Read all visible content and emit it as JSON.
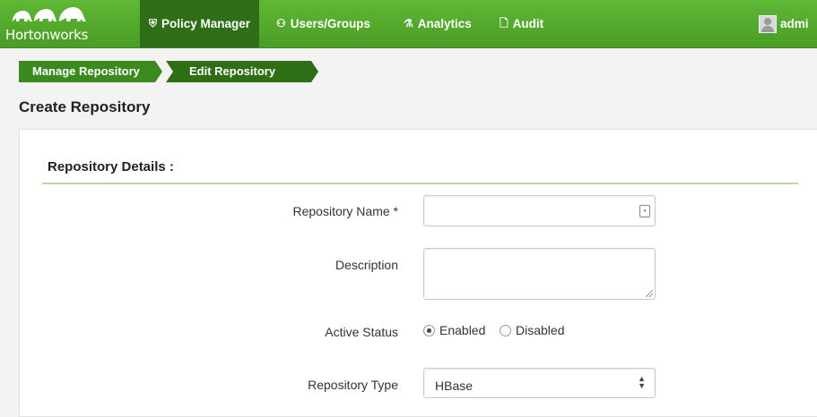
{
  "brand": {
    "name": "Hortonworks"
  },
  "nav": {
    "items": [
      {
        "label": "Policy Manager",
        "icon": "shield-icon",
        "active": true
      },
      {
        "label": "Users/Groups",
        "icon": "users-icon",
        "active": false
      },
      {
        "label": "Analytics",
        "icon": "flask-icon",
        "active": false
      },
      {
        "label": "Audit",
        "icon": "document-icon",
        "active": false
      }
    ],
    "user": "admi"
  },
  "breadcrumb": [
    "Manage Repository",
    "Edit Repository"
  ],
  "page": {
    "title": "Create Repository"
  },
  "form": {
    "section_title": "Repository Details :",
    "repository_name": {
      "label": "Repository Name *",
      "value": ""
    },
    "description": {
      "label": "Description",
      "value": ""
    },
    "active_status": {
      "label": "Active Status",
      "options": [
        "Enabled",
        "Disabled"
      ],
      "selected": "Enabled"
    },
    "repository_type": {
      "label": "Repository Type",
      "value": "HBase"
    }
  },
  "colors": {
    "nav_green": "#4fa72b",
    "nav_active": "#2f6d17",
    "crumb_green": "#3b8a1f"
  }
}
